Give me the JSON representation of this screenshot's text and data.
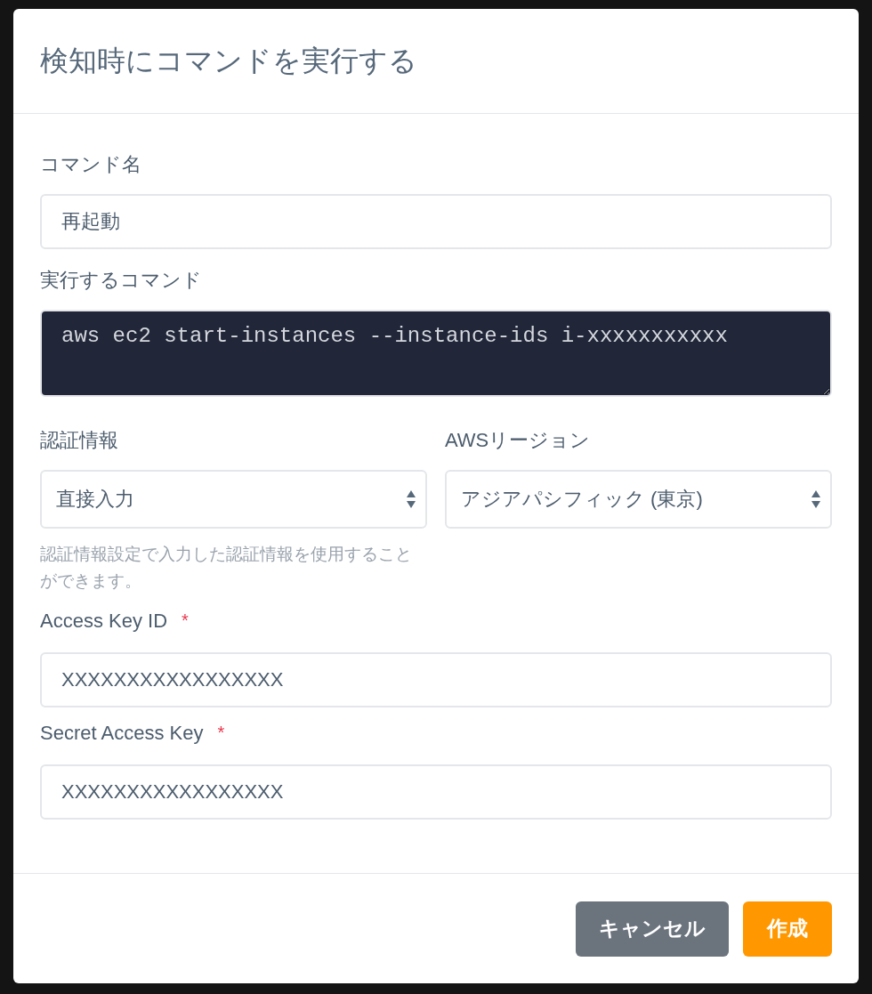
{
  "dialog": {
    "title": "検知時にコマンドを実行する"
  },
  "fields": [
    {
      "kind": "text",
      "label": "コマンド名",
      "value": "再起動"
    },
    {
      "kind": "code",
      "label": "実行するコマンド",
      "value": "aws ec2 start-instances --instance-ids i-xxxxxxxxxxx"
    }
  ],
  "selects": [
    {
      "label": "認証情報",
      "value": "直接入力",
      "help": "認証情報設定で入力した認証情報を使用することができます。"
    },
    {
      "label": "AWSリージョン",
      "value": "アジアパシフィック (東京)"
    }
  ],
  "credentials": [
    {
      "kind": "text",
      "label": "Access Key ID",
      "value": "XXXXXXXXXXXXXXXXX",
      "required_mark": "*"
    },
    {
      "kind": "text",
      "label": "Secret Access Key",
      "value": "XXXXXXXXXXXXXXXXX",
      "required_mark": "*"
    }
  ],
  "buttons": [
    {
      "label": "キャンセル",
      "kind": "secondary"
    },
    {
      "label": "作成",
      "kind": "primary"
    }
  ]
}
